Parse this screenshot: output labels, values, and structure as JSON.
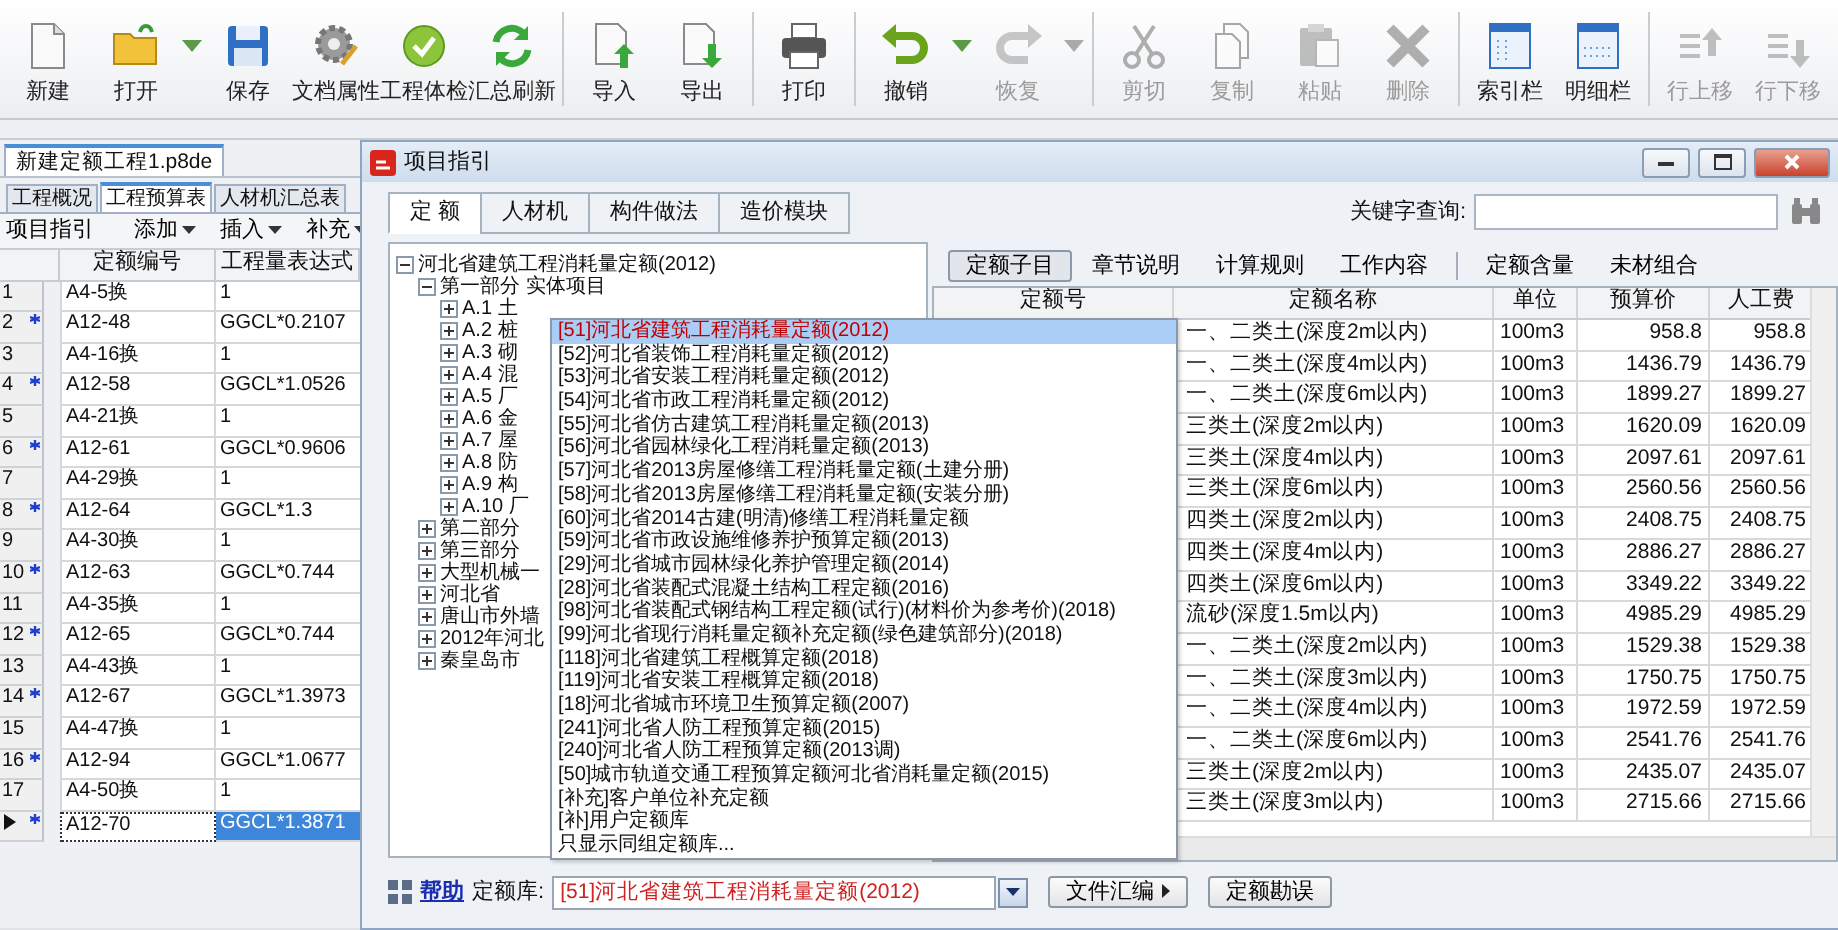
{
  "toolbar": {
    "groups": [
      [
        {
          "label": "新建",
          "disabled": false,
          "menu": false
        },
        {
          "label": "打开",
          "disabled": false,
          "menu": true
        },
        {
          "label": "保存",
          "disabled": false,
          "menu": false
        },
        {
          "label": "文档属性",
          "disabled": false,
          "menu": false
        },
        {
          "label": "工程体检",
          "disabled": false,
          "menu": false
        },
        {
          "label": "汇总刷新",
          "disabled": false,
          "menu": false
        }
      ],
      [
        {
          "label": "导入",
          "disabled": false,
          "menu": false
        },
        {
          "label": "导出",
          "disabled": false,
          "menu": false
        }
      ],
      [
        {
          "label": "打印",
          "disabled": false,
          "menu": false
        }
      ],
      [
        {
          "label": "撤销",
          "disabled": false,
          "menu": true
        },
        {
          "label": "恢复",
          "disabled": true,
          "menu": true
        }
      ],
      [
        {
          "label": "剪切",
          "disabled": true,
          "menu": false
        },
        {
          "label": "复制",
          "disabled": true,
          "menu": false
        },
        {
          "label": "粘贴",
          "disabled": true,
          "menu": false
        },
        {
          "label": "删除",
          "disabled": true,
          "menu": false
        }
      ],
      [
        {
          "label": "索引栏",
          "disabled": false,
          "menu": false
        },
        {
          "label": "明细栏",
          "disabled": false,
          "menu": false
        }
      ],
      [
        {
          "label": "行上移",
          "disabled": true,
          "menu": false
        },
        {
          "label": "行下移",
          "disabled": true,
          "menu": false
        }
      ]
    ]
  },
  "document_tab": "新建定额工程1.p8de",
  "sheet_tabs": [
    {
      "label": "工程概况",
      "selected": false
    },
    {
      "label": "工程预算表",
      "selected": true
    },
    {
      "label": "人材机汇总表",
      "selected": false
    }
  ],
  "sub_toolbar": [
    {
      "label": "项目指引",
      "menu": false
    },
    {
      "label": "添加",
      "menu": true
    },
    {
      "label": "插入",
      "menu": true
    },
    {
      "label": "补充",
      "menu": true
    }
  ],
  "quota_table": {
    "columns": [
      "定额编号",
      "工程量表达式"
    ],
    "rows": [
      {
        "number": "1",
        "code": "A4-5换",
        "expression": "1",
        "marked": false,
        "current": false,
        "selected": false
      },
      {
        "number": "2",
        "code": "A12-48",
        "expression": "GGCL*0.2107",
        "marked": true,
        "current": false,
        "selected": false
      },
      {
        "number": "3",
        "code": "A4-16换",
        "expression": "1",
        "marked": false,
        "current": false,
        "selected": false
      },
      {
        "number": "4",
        "code": "A12-58",
        "expression": "GGCL*1.0526",
        "marked": true,
        "current": false,
        "selected": false
      },
      {
        "number": "5",
        "code": "A4-21换",
        "expression": "1",
        "marked": false,
        "current": false,
        "selected": false
      },
      {
        "number": "6",
        "code": "A12-61",
        "expression": "GGCL*0.9606",
        "marked": true,
        "current": false,
        "selected": false
      },
      {
        "number": "7",
        "code": "A4-29换",
        "expression": "1",
        "marked": false,
        "current": false,
        "selected": false
      },
      {
        "number": "8",
        "code": "A12-64",
        "expression": "GGCL*1.3",
        "marked": true,
        "current": false,
        "selected": false
      },
      {
        "number": "9",
        "code": "A4-30换",
        "expression": "1",
        "marked": false,
        "current": false,
        "selected": false
      },
      {
        "number": "10",
        "code": "A12-63",
        "expression": "GGCL*0.744",
        "marked": true,
        "current": false,
        "selected": false
      },
      {
        "number": "11",
        "code": "A4-35换",
        "expression": "1",
        "marked": false,
        "current": false,
        "selected": false
      },
      {
        "number": "12",
        "code": "A12-65",
        "expression": "GGCL*0.744",
        "marked": true,
        "current": false,
        "selected": false
      },
      {
        "number": "13",
        "code": "A4-43换",
        "expression": "1",
        "marked": false,
        "current": false,
        "selected": false
      },
      {
        "number": "14",
        "code": "A12-67",
        "expression": "GGCL*1.3973",
        "marked": true,
        "current": false,
        "selected": false
      },
      {
        "number": "15",
        "code": "A4-47换",
        "expression": "1",
        "marked": false,
        "current": false,
        "selected": false
      },
      {
        "number": "16",
        "code": "A12-94",
        "expression": "GGCL*1.0677",
        "marked": true,
        "current": false,
        "selected": false
      },
      {
        "number": "17",
        "code": "A4-50换",
        "expression": "1",
        "marked": false,
        "current": false,
        "selected": false
      },
      {
        "code": "A12-70",
        "expression": "GGCL*1.3871",
        "marked": true,
        "current": true,
        "selected": true
      }
    ]
  },
  "dialog": {
    "title": "项目指引",
    "tabs": [
      {
        "label": "定 额",
        "selected": true
      },
      {
        "label": "人材机",
        "selected": false
      },
      {
        "label": "构件做法",
        "selected": false
      },
      {
        "label": "造价模块",
        "selected": false
      }
    ],
    "search": {
      "label": "关键字查询:"
    },
    "tree": [
      {
        "label": "河北省建筑工程消耗量定额(2012)",
        "expanded": true,
        "children": [
          {
            "label": "第一部分 实体项目",
            "expanded": true,
            "children": [
              {
                "label": "A.1 土",
                "expanded": false
              },
              {
                "label": "A.2 桩",
                "expanded": false
              },
              {
                "label": "A.3 砌",
                "expanded": false
              },
              {
                "label": "A.4 混",
                "expanded": false
              },
              {
                "label": "A.5 厂",
                "expanded": false
              },
              {
                "label": "A.6 金",
                "expanded": false
              },
              {
                "label": "A.7 屋",
                "expanded": false
              },
              {
                "label": "A.8 防",
                "expanded": false
              },
              {
                "label": "A.9 构",
                "expanded": false
              },
              {
                "label": "A.10 厂",
                "expanded": false
              }
            ]
          },
          {
            "label": "第二部分",
            "expanded": false
          },
          {
            "label": "第三部分",
            "expanded": false
          },
          {
            "label": "大型机械一",
            "expanded": false
          },
          {
            "label": "河北省",
            "expanded": false
          },
          {
            "label": "唐山市外墙",
            "expanded": false
          },
          {
            "label": "2012年河北",
            "expanded": false
          },
          {
            "label": "秦皇岛市",
            "expanded": false
          }
        ]
      }
    ],
    "detail_tabs": [
      [
        {
          "label": "定额子目",
          "selected": true
        },
        {
          "label": "章节说明",
          "selected": false
        },
        {
          "label": "计算规则",
          "selected": false
        },
        {
          "label": "工作内容",
          "selected": false
        }
      ],
      [
        {
          "label": "定额含量",
          "selected": false
        },
        {
          "label": "未材组合",
          "selected": false
        }
      ]
    ],
    "table": {
      "columns": [
        "定额号",
        "定额名称",
        "单位",
        "预算价",
        "人工费"
      ],
      "rows": [
        {
          "name": "一、二类土(深度2m以内)",
          "unit": "100m3",
          "price": "958.8",
          "labor": "958.8"
        },
        {
          "name": "一、二类土(深度4m以内)",
          "unit": "100m3",
          "price": "1436.79",
          "labor": "1436.79"
        },
        {
          "name": "一、二类土(深度6m以内)",
          "unit": "100m3",
          "price": "1899.27",
          "labor": "1899.27"
        },
        {
          "name": "三类土(深度2m以内)",
          "unit": "100m3",
          "price": "1620.09",
          "labor": "1620.09"
        },
        {
          "name": "三类土(深度4m以内)",
          "unit": "100m3",
          "price": "2097.61",
          "labor": "2097.61"
        },
        {
          "name": "三类土(深度6m以内)",
          "unit": "100m3",
          "price": "2560.56",
          "labor": "2560.56"
        },
        {
          "name": "四类土(深度2m以内)",
          "unit": "100m3",
          "price": "2408.75",
          "labor": "2408.75"
        },
        {
          "name": "四类土(深度4m以内)",
          "unit": "100m3",
          "price": "2886.27",
          "labor": "2886.27"
        },
        {
          "name": "四类土(深度6m以内)",
          "unit": "100m3",
          "price": "3349.22",
          "labor": "3349.22"
        },
        {
          "name": "流砂(深度1.5m以内)",
          "unit": "100m3",
          "price": "4985.29",
          "labor": "4985.29"
        },
        {
          "name": "一、二类土(深度2m以内)",
          "unit": "100m3",
          "price": "1529.38",
          "labor": "1529.38"
        },
        {
          "name": "一、二类土(深度3m以内)",
          "unit": "100m3",
          "price": "1750.75",
          "labor": "1750.75"
        },
        {
          "name": "一、二类土(深度4m以内)",
          "unit": "100m3",
          "price": "1972.59",
          "labor": "1972.59"
        },
        {
          "name": "一、二类土(深度6m以内)",
          "unit": "100m3",
          "price": "2541.76",
          "labor": "2541.76"
        },
        {
          "name": "三类土(深度2m以内)",
          "unit": "100m3",
          "price": "2435.07",
          "labor": "2435.07"
        },
        {
          "name": "三类土(深度3m以内)",
          "unit": "100m3",
          "price": "2715.66",
          "labor": "2715.66"
        }
      ]
    },
    "dropdown": {
      "items": [
        {
          "label": "[51]河北省建筑工程消耗量定额(2012)",
          "selected": true
        },
        {
          "label": "[52]河北省装饰工程消耗量定额(2012)",
          "selected": false
        },
        {
          "label": "[53]河北省安装工程消耗量定额(2012)",
          "selected": false
        },
        {
          "label": "[54]河北省市政工程消耗量定额(2012)",
          "selected": false
        },
        {
          "label": "[55]河北省仿古建筑工程消耗量定额(2013)",
          "selected": false
        },
        {
          "label": "[56]河北省园林绿化工程消耗量定额(2013)",
          "selected": false
        },
        {
          "label": "[57]河北省2013房屋修缮工程消耗量定额(土建分册)",
          "selected": false
        },
        {
          "label": "[58]河北省2013房屋修缮工程消耗量定额(安装分册)",
          "selected": false
        },
        {
          "label": "[60]河北省2014古建(明清)修缮工程消耗量定额",
          "selected": false
        },
        {
          "label": "[59]河北省市政设施维修养护预算定额(2013)",
          "selected": false
        },
        {
          "label": "[29]河北省城市园林绿化养护管理定额(2014)",
          "selected": false
        },
        {
          "label": "[28]河北省装配式混凝土结构工程定额(2016)",
          "selected": false
        },
        {
          "label": "[98]河北省装配式钢结构工程定额(试行)(材料价为参考价)(2018)",
          "selected": false
        },
        {
          "label": "[99]河北省现行消耗量定额补充定额(绿色建筑部分)(2018)",
          "selected": false
        },
        {
          "label": "[118]河北省建筑工程概算定额(2018)",
          "selected": false
        },
        {
          "label": "[119]河北省安装工程概算定额(2018)",
          "selected": false
        },
        {
          "label": "[18]河北省城市环境卫生预算定额(2007)",
          "selected": false
        },
        {
          "label": "[241]河北省人防工程预算定额(2015)",
          "selected": false
        },
        {
          "label": "[240]河北省人防工程预算定额(2013调)",
          "selected": false
        },
        {
          "label": "[50]城市轨道交通工程预算定额河北省消耗量定额(2015)",
          "selected": false
        },
        {
          "label": "[补充]客户单位补充定额",
          "selected": false
        },
        {
          "label": "[补]用户定额库",
          "selected": false
        },
        {
          "label": "只显示同组定额库...",
          "selected": false
        }
      ]
    },
    "footer": {
      "help": "帮助",
      "library_label": "定额库:",
      "library_value": "[51]河北省建筑工程消耗量定额(2012)",
      "buttons": [
        {
          "label": "文件汇编",
          "arrow": true
        },
        {
          "label": "定额勘误",
          "arrow": false
        }
      ]
    }
  }
}
